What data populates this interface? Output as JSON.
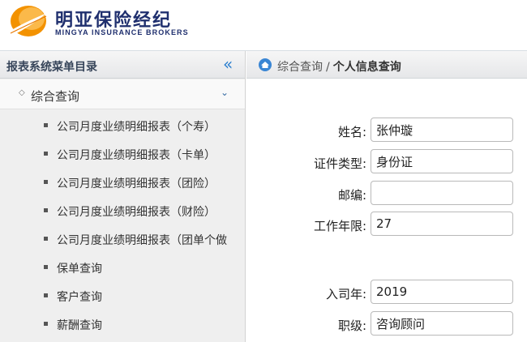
{
  "brand": {
    "name_cn": "明亚保险经纪",
    "name_en": "MINGYA INSURANCE BROKERS",
    "logo": "sun-swoosh-logo"
  },
  "sidebar": {
    "title": "报表系统菜单目录",
    "collapse_icon": "double-chevron-left-icon",
    "group": {
      "label": "综合查询",
      "expanded": true,
      "chevron_icon": "chevron-down-icon"
    },
    "items": [
      {
        "label": "公司月度业绩明细报表（个寿）"
      },
      {
        "label": "公司月度业绩明细报表（卡单）"
      },
      {
        "label": "公司月度业绩明细报表（团险）"
      },
      {
        "label": "公司月度业绩明细报表（财险）"
      },
      {
        "label": "公司月度业绩明细报表（团单个做"
      },
      {
        "label": "保单查询"
      },
      {
        "label": "客户查询"
      },
      {
        "label": "薪酬查询"
      }
    ]
  },
  "breadcrumb": {
    "home_icon": "home-icon",
    "parent": "综合查询",
    "separator": "/",
    "current": "个人信息查询"
  },
  "form": {
    "name": {
      "label": "姓名:",
      "value": "张仲璇"
    },
    "id_type": {
      "label": "证件类型:",
      "value": "身份证"
    },
    "postcode": {
      "label": "邮编:",
      "value": ""
    },
    "work_years": {
      "label": "工作年限:",
      "value": "27"
    },
    "join_year": {
      "label": "入司年:",
      "value": "2019"
    },
    "rank": {
      "label": "职级:",
      "value": "咨询顾问"
    }
  },
  "colors": {
    "brand_blue": "#1f2f6e",
    "accent_blue": "#2b7fcf",
    "logo_orange": "#f39200"
  }
}
